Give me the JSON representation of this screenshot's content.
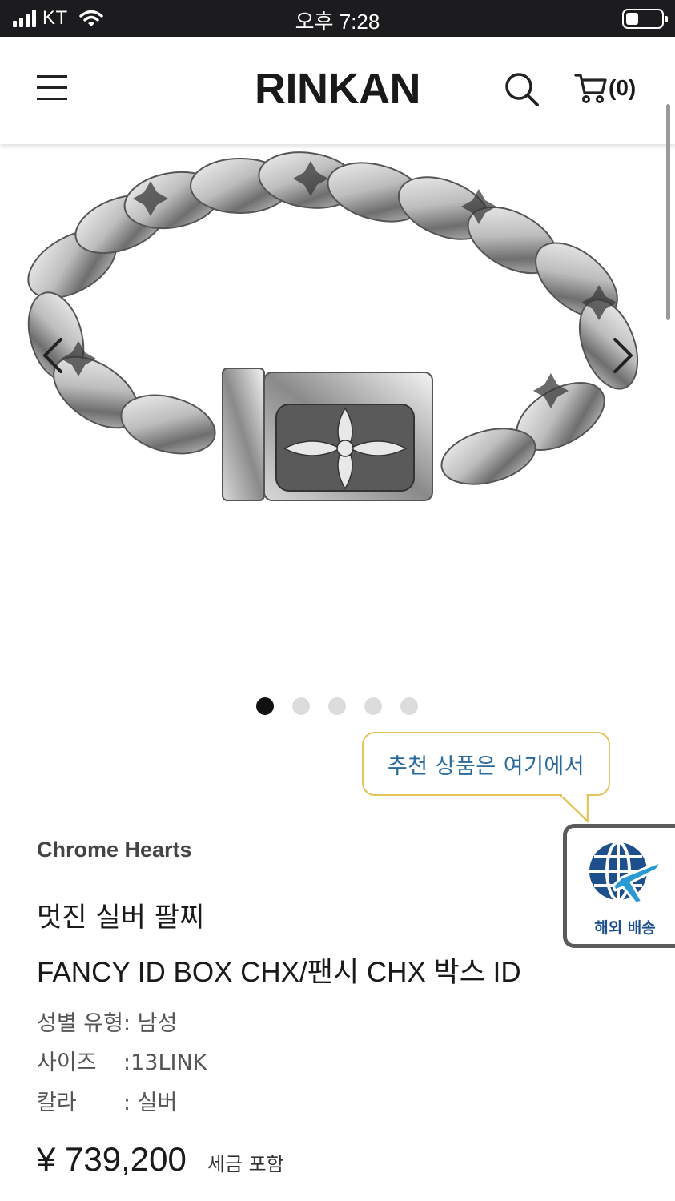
{
  "status_bar": {
    "carrier": "KT",
    "time": "오후 7:28"
  },
  "header": {
    "logo": "RINKAN",
    "cart_count": "(0)",
    "menu_icon": "hamburger-menu-icon",
    "search_icon": "search-icon",
    "cart_icon": "cart-icon"
  },
  "gallery": {
    "image": "silver-bracelet-photo",
    "slide_count": 5,
    "active_slide": 1
  },
  "tooltip": {
    "text": "추천 상품은 여기에서"
  },
  "overseas": {
    "label": "해외 배송",
    "icon": "globe-airplane-icon"
  },
  "product": {
    "brand": "Chrome Hearts",
    "name_kr": "멋진 실버 팔찌",
    "name_en": "FANCY ID BOX CHX/팬시 CHX 박스 ID",
    "specs": [
      {
        "key": "성별 유형: 남성",
        "value": ""
      },
      {
        "key": "사이즈",
        "value": ":13LINK"
      },
      {
        "key": "칼라",
        "value": ": 실버"
      }
    ],
    "price": "¥ 739,200",
    "tax_note": "세금 포함"
  },
  "colors": {
    "accent_tooltip_border": "#e3c35a",
    "tooltip_text": "#2a6a9c",
    "shipping_blue": "#1d4f8c"
  }
}
